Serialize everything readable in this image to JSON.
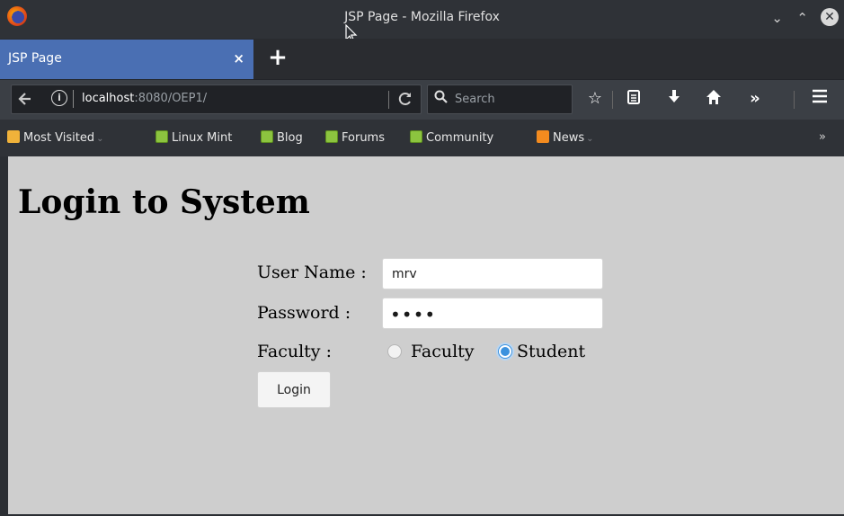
{
  "window": {
    "title": "JSP Page - Mozilla Firefox",
    "controls": {
      "minimize": "⌄",
      "maximize": "⌃",
      "close": "✕"
    }
  },
  "tabs": [
    {
      "label": "JSP Page",
      "active": true,
      "close": "×"
    }
  ],
  "new_tab": "+",
  "navbar": {
    "url_host": "localhost",
    "url_rest": ":8080/OEP1/",
    "search_placeholder": "Search",
    "icons": [
      "back-arrow-icon",
      "info-icon",
      "reload-icon",
      "search-icon",
      "bookmark-star-icon",
      "reader-list-icon",
      "download-icon",
      "home-icon",
      "overflow-chevrons-icon",
      "hamburger-menu-icon"
    ]
  },
  "bookmarks": [
    {
      "label": "Most Visited",
      "icon": "most-visited-icon",
      "dropdown": true
    },
    {
      "label": "Linux Mint",
      "icon": "linux-mint-icon"
    },
    {
      "label": "Blog",
      "icon": "linux-mint-icon"
    },
    {
      "label": "Forums",
      "icon": "linux-mint-icon"
    },
    {
      "label": "Community",
      "icon": "linux-mint-icon"
    },
    {
      "label": "News",
      "icon": "rss-icon",
      "dropdown": true
    }
  ],
  "bookmarks_overflow": "»",
  "page": {
    "heading": "Login to System",
    "username_label": "User Name :",
    "username_value": "mrv",
    "password_label": "Password :",
    "password_mask": "••••",
    "faculty_label": "Faculty :",
    "radio_faculty": "Faculty",
    "radio_student": "Student",
    "selected_role": "Student",
    "login_button": "Login"
  },
  "colors": {
    "tab_active": "#4a6fb3",
    "content_bg": "#cecece",
    "radio_selected": "#3c92de"
  }
}
